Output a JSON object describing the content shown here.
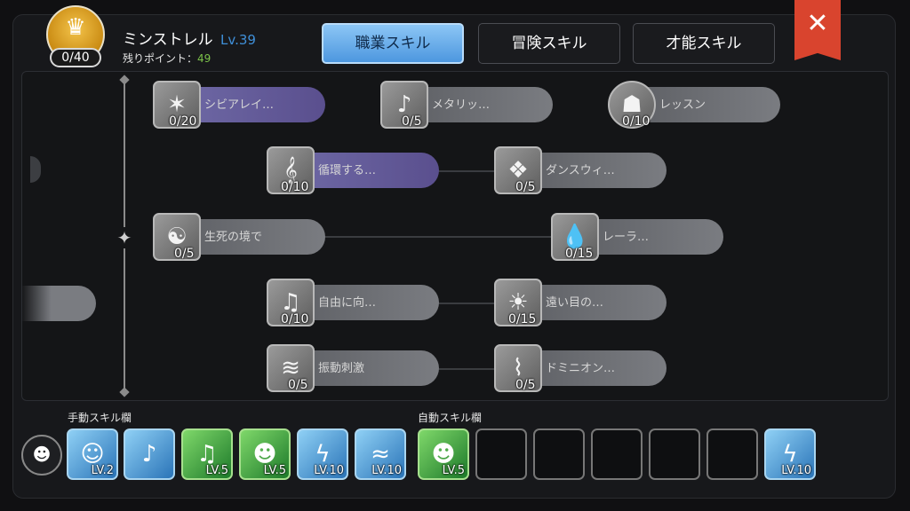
{
  "header": {
    "points_used": "0/40",
    "character_name": "ミンストレル",
    "level": "Lv.39",
    "remaining_label": "残りポイント：",
    "remaining_value": "49"
  },
  "tabs": [
    {
      "label": "職業スキル",
      "active": true
    },
    {
      "label": "冒険スキル",
      "active": false
    },
    {
      "label": "才能スキル",
      "active": false
    }
  ],
  "close": {
    "label": "✕"
  },
  "skills": [
    {
      "name": "シビアレイ…",
      "count": "0/20",
      "icon": "light-burst-icon"
    },
    {
      "name": "メタリッ…",
      "count": "0/5",
      "icon": "metallic-note-icon"
    },
    {
      "name": "レッスン",
      "count": "0/10",
      "icon": "lesson-book-icon"
    },
    {
      "name": "循環する…",
      "count": "0/10",
      "icon": "music-clef-icon"
    },
    {
      "name": "ダンスウィ…",
      "count": "0/5",
      "icon": "dance-wing-icon"
    },
    {
      "name": "生死の境で",
      "count": "0/5",
      "icon": "life-death-icon"
    },
    {
      "name": "レーラ…",
      "count": "0/15",
      "icon": "water-drop-icon"
    },
    {
      "name": "自由に向…",
      "count": "0/10",
      "icon": "music-notes-icon"
    },
    {
      "name": "遠い目の…",
      "count": "0/15",
      "icon": "distant-eye-icon"
    },
    {
      "name": "振動刺激",
      "count": "0/5",
      "icon": "vibration-icon"
    },
    {
      "name": "ドミニオン…",
      "count": "0/5",
      "icon": "dominion-bat-icon"
    }
  ],
  "slots": {
    "manual_label": "手動スキル欄",
    "auto_label": "自動スキル欄",
    "manual": [
      {
        "level": "LV.2",
        "color": "blue",
        "icon": "figure-icon"
      },
      {
        "level": "",
        "color": "blue",
        "icon": "dancer-icon"
      },
      {
        "level": "LV.5",
        "color": "green",
        "icon": "notes-icon"
      },
      {
        "level": "LV.5",
        "color": "green",
        "icon": "singer-icon"
      },
      {
        "level": "LV.10",
        "color": "blue",
        "icon": "lightning-icon"
      },
      {
        "level": "LV.10",
        "color": "blue",
        "icon": "wave-icon"
      }
    ],
    "auto": [
      {
        "level": "LV.5",
        "color": "green",
        "icon": "singer-icon"
      },
      {
        "level": "",
        "color": "empty",
        "icon": ""
      },
      {
        "level": "",
        "color": "empty",
        "icon": ""
      },
      {
        "level": "",
        "color": "empty",
        "icon": ""
      },
      {
        "level": "",
        "color": "empty",
        "icon": ""
      },
      {
        "level": "",
        "color": "empty",
        "icon": ""
      },
      {
        "level": "LV.10",
        "color": "blue",
        "icon": "lightning-icon"
      }
    ]
  }
}
